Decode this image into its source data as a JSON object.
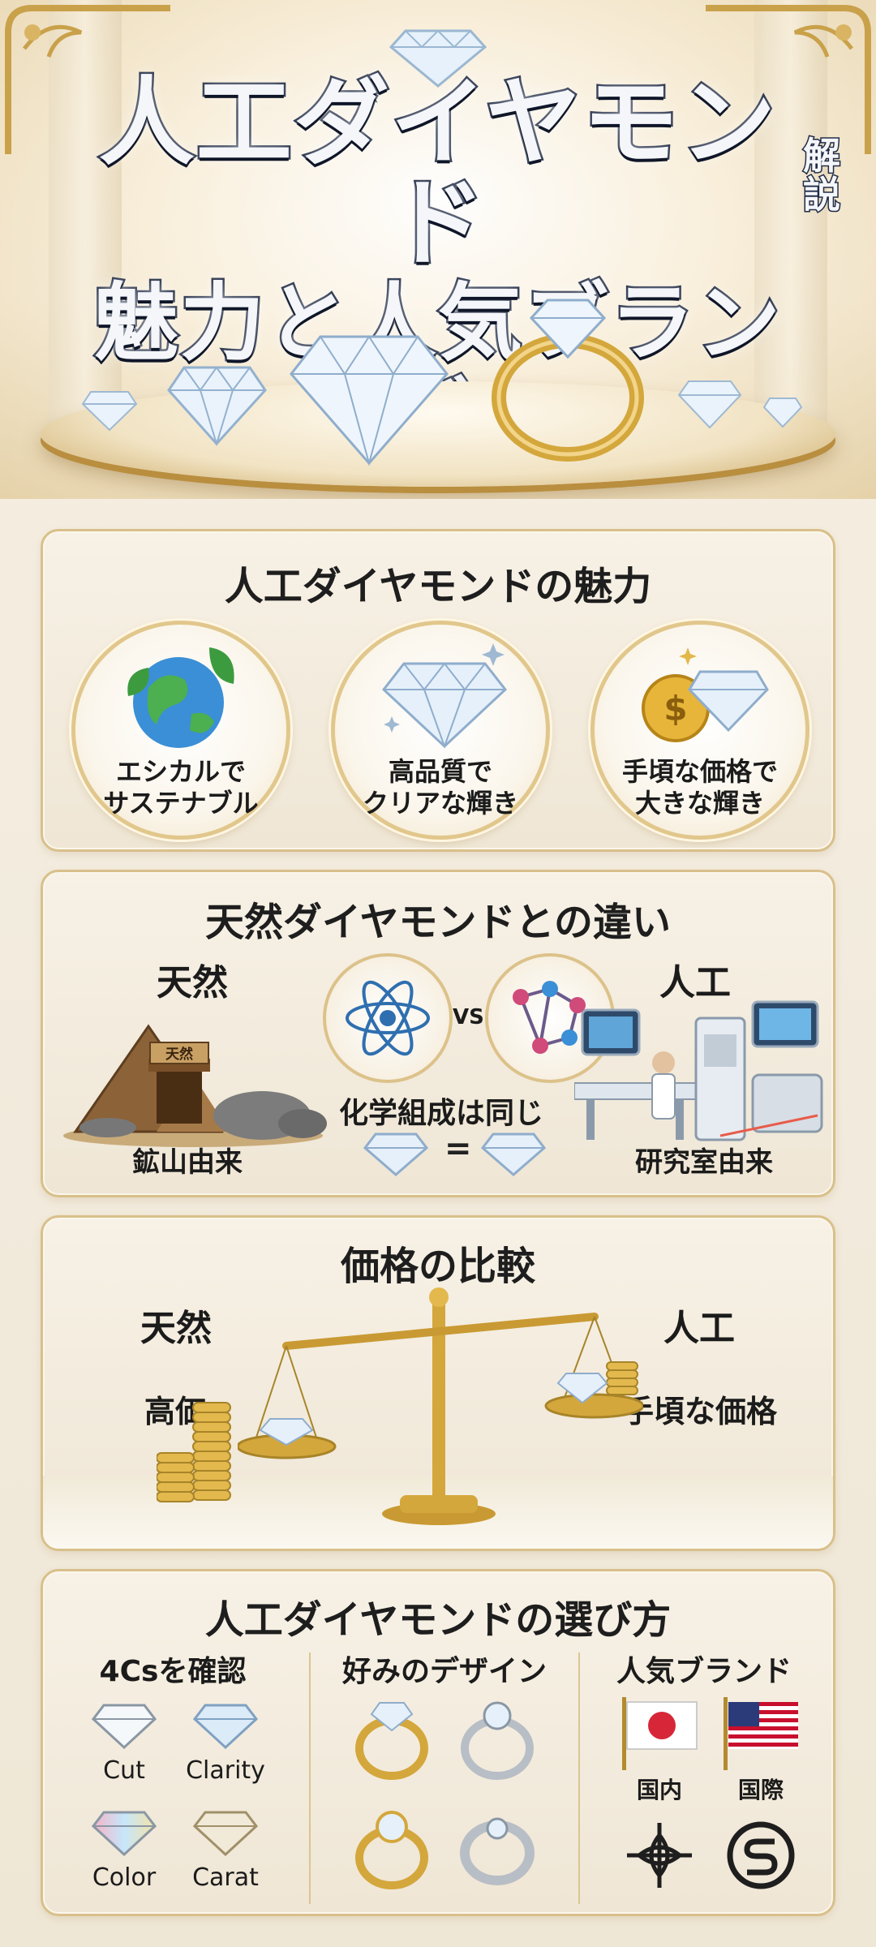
{
  "hero": {
    "title_line1": "人工ダイヤモンド",
    "title_line2": "魅力と人気ブランド",
    "title_tag": "解説"
  },
  "appeal": {
    "title": "人工ダイヤモンドの魅力",
    "features": [
      {
        "line1": "エシカルで",
        "line2": "サステナブル",
        "icon": "earth-leaf-icon"
      },
      {
        "line1": "高品質で",
        "line2": "クリアな輝き",
        "icon": "diamond-sparkle-icon"
      },
      {
        "line1": "手頃な価格で",
        "line2": "大きな輝き",
        "icon": "coin-diamond-icon"
      }
    ]
  },
  "difference": {
    "title": "天然ダイヤモンドとの違い",
    "natural_label": "天然",
    "natural_caption": "鉱山由来",
    "mine_sign": "天然",
    "lab_label": "人工",
    "lab_caption": "研究室由来",
    "vs": "VS",
    "composition": "化学組成は同じ",
    "equals": "="
  },
  "price": {
    "title": "価格の比較",
    "natural_label": "天然",
    "natural_value": "高価",
    "lab_label": "人工",
    "lab_value": "手頃な価格"
  },
  "choose": {
    "title": "人工ダイヤモンドの選び方",
    "col1_title": "4Csを確認",
    "cs": [
      "Cut",
      "Clarity",
      "Color",
      "Carat"
    ],
    "col2_title": "好みのデザイン",
    "col3_title": "人気ブランド",
    "domestic": "国内",
    "international": "国際"
  },
  "colors": {
    "gold": "#d4a73c",
    "navy": "#1f2a44",
    "diamond": "#cfe3f6"
  }
}
